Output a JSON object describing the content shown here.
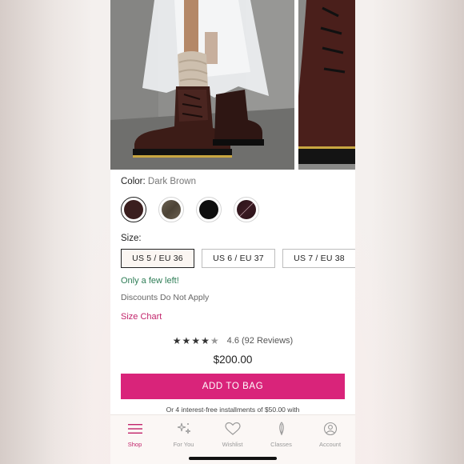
{
  "product": {
    "color_label": "Color:",
    "color_value": "Dark Brown",
    "swatches": [
      {
        "name": "Dark Brown",
        "color": "#3a1e1e"
      },
      {
        "name": "Olive Brown",
        "color": "#5b5142"
      },
      {
        "name": "Black",
        "color": "#0f0f0f"
      },
      {
        "name": "Burgundy",
        "color": "#3a1a22"
      }
    ],
    "size_label": "Size:",
    "sizes": [
      "US 5 / EU 36",
      "US 6 / EU 37",
      "US 7 / EU 38"
    ],
    "selected_size": "US 5 / EU 36",
    "stock_status": "Only a few left!",
    "discount_note": "Discounts Do Not Apply",
    "size_chart_link": "Size Chart",
    "rating": {
      "stars": "★★★★",
      "half_star": "★",
      "score": 4.6,
      "text": "4.6 (92 Reviews)"
    },
    "price": "$200.00",
    "add_to_bag": "ADD TO BAG",
    "installments": "Or 4 interest-free installments of $50.00 with"
  },
  "nav": {
    "items": [
      {
        "label": "Shop",
        "icon": "menu-lines-icon",
        "active": true
      },
      {
        "label": "For You",
        "icon": "sparkle-icon",
        "active": false
      },
      {
        "label": "Wishlist",
        "icon": "heart-icon",
        "active": false
      },
      {
        "label": "Classes",
        "icon": "feather-icon",
        "active": false
      },
      {
        "label": "Account",
        "icon": "account-icon",
        "active": false
      }
    ]
  },
  "colors": {
    "accent": "#d9247a",
    "accent_text": "#c2246b",
    "stock_green": "#2e7d56"
  }
}
